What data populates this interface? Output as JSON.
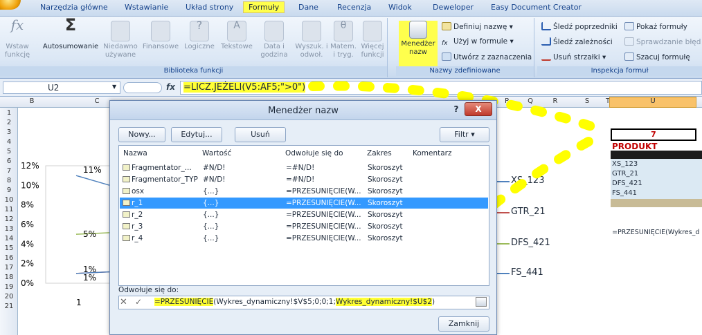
{
  "ribbon": {
    "tabs": [
      "Narzędzia główne",
      "Wstawianie",
      "Układ strony",
      "Formuły",
      "Dane",
      "Recenzja",
      "Widok",
      "Deweloper",
      "Easy Document Creator"
    ],
    "active_tab": "Formuły",
    "groups": {
      "function_library": {
        "label": "Biblioteka funkcji",
        "insert_function": "Wstaw funkcję",
        "autosum": "Autosumowanie",
        "recently_used": "Niedawno używane",
        "financial": "Finansowe",
        "logical": "Logiczne",
        "text": "Tekstowe",
        "date_time": "Data i godzina",
        "lookup": "Wyszuk. i odwoł.",
        "math": "Matem. i tryg.",
        "more": "Więcej funkcji"
      },
      "defined_names": {
        "label": "Nazwy zdefiniowane",
        "name_manager": "Menedżer nazw",
        "define_name": "Definiuj nazwę",
        "use_in_formula": "Użyj w formule",
        "create_from_selection": "Utwórz z zaznaczenia"
      },
      "formula_auditing": {
        "label": "Inspekcja formuł",
        "trace_precedents": "Śledź poprzedniki",
        "trace_dependents": "Śledź zależności",
        "remove_arrows": "Usuń strzałki",
        "show_formulas": "Pokaż formuły",
        "error_checking": "Sprawdzanie błęd",
        "evaluate_formula": "Szacuj formułę"
      }
    }
  },
  "formula_bar": {
    "cell_ref": "U2",
    "fx": "fx",
    "formula": "=LICZ.JEŻELI(V5:AF5;\">0\")"
  },
  "sheet": {
    "columns": [
      "B",
      "C",
      "P",
      "Q",
      "R",
      "S",
      "T",
      "U"
    ],
    "rows": [
      "1",
      "2",
      "3",
      "4",
      "5",
      "6",
      "7",
      "8",
      "9",
      "10",
      "11",
      "12",
      "13",
      "14",
      "15",
      "16",
      "17",
      "18",
      "19",
      "20",
      "21"
    ],
    "u2_value": "7",
    "produkt_header": "PRODUKT",
    "products": [
      "XS_123",
      "GTR_21",
      "DFS_421",
      "FS_441"
    ],
    "right_formula": "=PRZESUNIĘCIE(Wykres_d"
  },
  "chart_data": {
    "type": "line",
    "y_ticks": [
      "0%",
      "2%",
      "4%",
      "6%",
      "8%",
      "10%",
      "12%"
    ],
    "ylim": [
      0,
      0.12
    ],
    "x_ticks": [
      "1"
    ],
    "data_labels": [
      "11%",
      "5%",
      "1%",
      "1%"
    ],
    "series": [
      {
        "name": "XS_123",
        "start": 0.11,
        "color": "#4f81bd"
      },
      {
        "name": "GTR_21",
        "start": 0.01,
        "color": "#c0504d"
      },
      {
        "name": "DFS_421",
        "start": 0.05,
        "color": "#9bbb59"
      },
      {
        "name": "FS_441",
        "start": 0.01,
        "color": "#4f81bd"
      }
    ],
    "legend_position": "right"
  },
  "dialog": {
    "title": "Menedżer nazw",
    "help": "?",
    "close_x": "X",
    "buttons": {
      "new": "Nowy...",
      "edit": "Edytuj...",
      "delete": "Usuń",
      "filter": "Filtr",
      "close": "Zamknij"
    },
    "columns": [
      "Nazwa",
      "Wartość",
      "Odwołuje się do",
      "Zakres",
      "Komentarz"
    ],
    "rows": [
      {
        "name": "Fragmentator_...",
        "value": "#N/D!",
        "refers": "=#N/D!",
        "scope": "Skoroszyt",
        "comment": ""
      },
      {
        "name": "Fragmentator_TYP",
        "value": "#N/D!",
        "refers": "=#N/D!",
        "scope": "Skoroszyt",
        "comment": ""
      },
      {
        "name": "osx",
        "value": "{...}",
        "refers": "=PRZESUNIĘCIE(W...",
        "scope": "Skoroszyt",
        "comment": ""
      },
      {
        "name": "r_1",
        "value": "{...}",
        "refers": "=PRZESUNIĘCIE(W...",
        "scope": "Skoroszyt",
        "comment": ""
      },
      {
        "name": "r_2",
        "value": "{...}",
        "refers": "=PRZESUNIĘCIE(W...",
        "scope": "Skoroszyt",
        "comment": ""
      },
      {
        "name": "r_3",
        "value": "{...}",
        "refers": "=PRZESUNIĘCIE(W...",
        "scope": "Skoroszyt",
        "comment": ""
      },
      {
        "name": "r_4",
        "value": "{...}",
        "refers": "=PRZESUNIĘCIE(W...",
        "scope": "Skoroszyt",
        "comment": ""
      }
    ],
    "selected_row": "r_1",
    "refers_to_label": "Odwołuje się do:",
    "refers_to_value": {
      "fn": "=PRZESUNIĘCIE",
      "mid": "(Wykres_dynamiczny!$V$5;0;0;1;",
      "hl2": "Wykres_dynamiczny!$U$2",
      "tail": ")"
    },
    "cancel_glyph": "✕",
    "confirm_glyph": "✓"
  },
  "colors": {
    "highlight": "#ffff33",
    "selection": "#3399ff",
    "accent": "#c00000"
  }
}
